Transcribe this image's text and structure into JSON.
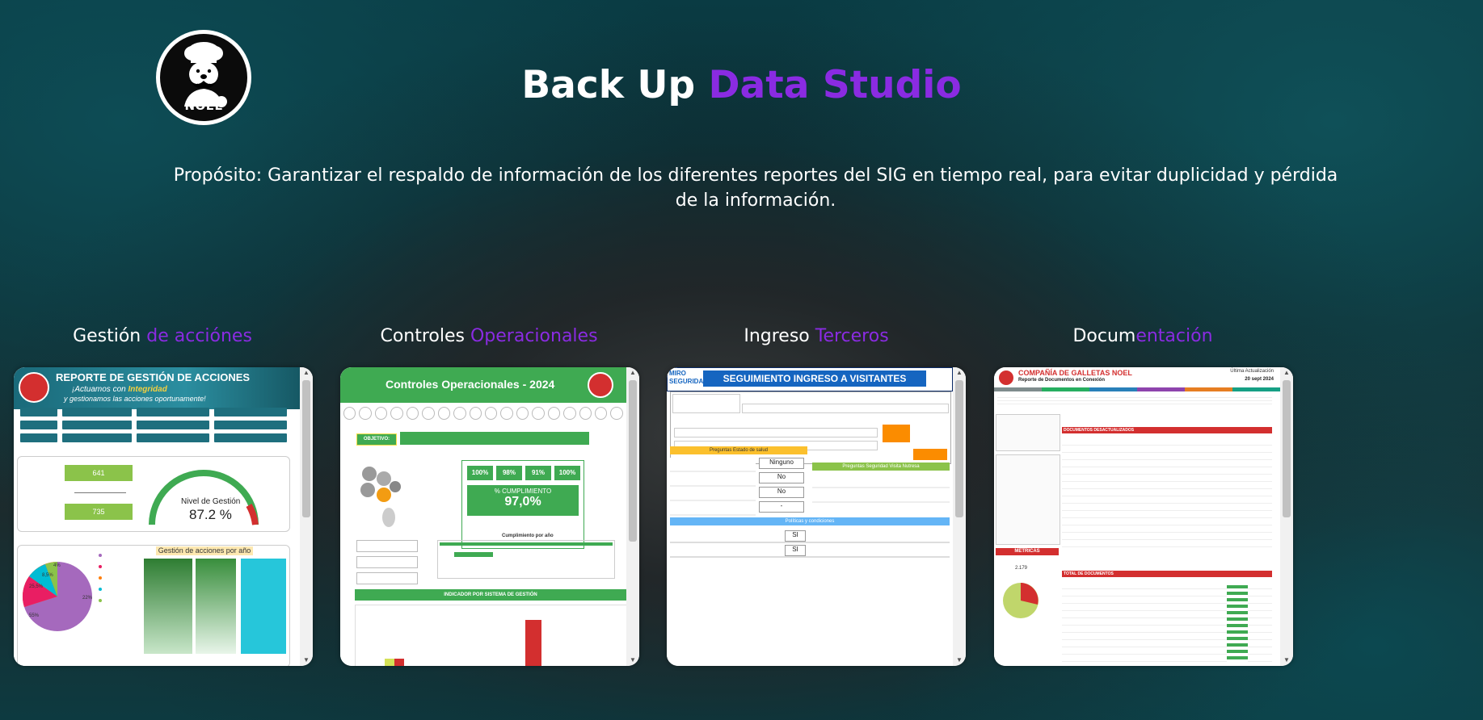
{
  "brand": {
    "logo_text": "NOEL"
  },
  "header": {
    "title_plain": "Back Up ",
    "title_accent": "Data Studio",
    "purpose": "Propósito: Garantizar el respaldo de información de los diferentes reportes del SIG en tiempo real, para evitar duplicidad y pérdida de la información."
  },
  "colors": {
    "accent": "#8a2be2",
    "text": "#ffffff"
  },
  "cards": [
    {
      "title_plain": "Gestión ",
      "title_accent": "de accióne",
      "title_tail": "s",
      "preview": {
        "heading": "REPORTE DE GESTIÓN DE ACCIONES",
        "line1_plain": "¡Actuamos con ",
        "line1_bold": "Integridad",
        "line2": "y gestionamos las acciones oportunamente!",
        "kpi_top_value": "641",
        "kpi_bottom_value": "735",
        "gauge_label": "Nivel de Gestión",
        "gauge_value": "87.2 %",
        "bar_title": "Gestión de acciones por año",
        "pie_labels": [
          "22%",
          "55%",
          "25,5%",
          "8,5%",
          "4%"
        ]
      }
    },
    {
      "title_plain": "Controles ",
      "title_accent": "Operacionales",
      "preview": {
        "heading": "Controles Operacionales - 2024",
        "objetivo": "OBJETIVO:",
        "kpis": [
          "100%",
          "98%",
          "91%",
          "100%"
        ],
        "cumplimiento_label": "% CUMPLIMIENTO",
        "cumplimiento_value": "97,0%",
        "indicador": "INDICADOR POR SISTEMA DE GESTIÓN",
        "cumplimiento_anio": "Cumplimiento por año"
      }
    },
    {
      "title_plain": "Ingreso ",
      "title_accent": "Terceros",
      "preview": {
        "heading": "SEGUIMIENTO INGRESO A VISITANTES",
        "logo": "MIRO SEGURIDAD",
        "preguntas_salud": "Preguntas Estado de salud",
        "preguntas_seguridad": "Preguntas Seguridad Visita Nutresa",
        "politicas": "Políticas y condiciones",
        "answers": [
          "Ninguno",
          "No",
          "No",
          "-"
        ],
        "si": [
          "SI",
          "SI"
        ]
      }
    },
    {
      "title_plain": "Docum",
      "title_accent": "entación",
      "preview": {
        "company": "COMPAÑÍA DE GALLETAS NOEL",
        "report": "Reporte de Documentos en Conexión",
        "update_label": "Última Actualización",
        "update_date": "20 sept 2024",
        "desactualizados": "DOCUMENTOS DESACTUALIZADOS",
        "metricas": "METRICAS",
        "total": "TOTAL DE DOCUMENTOS",
        "metric_value": "2.179"
      }
    }
  ]
}
